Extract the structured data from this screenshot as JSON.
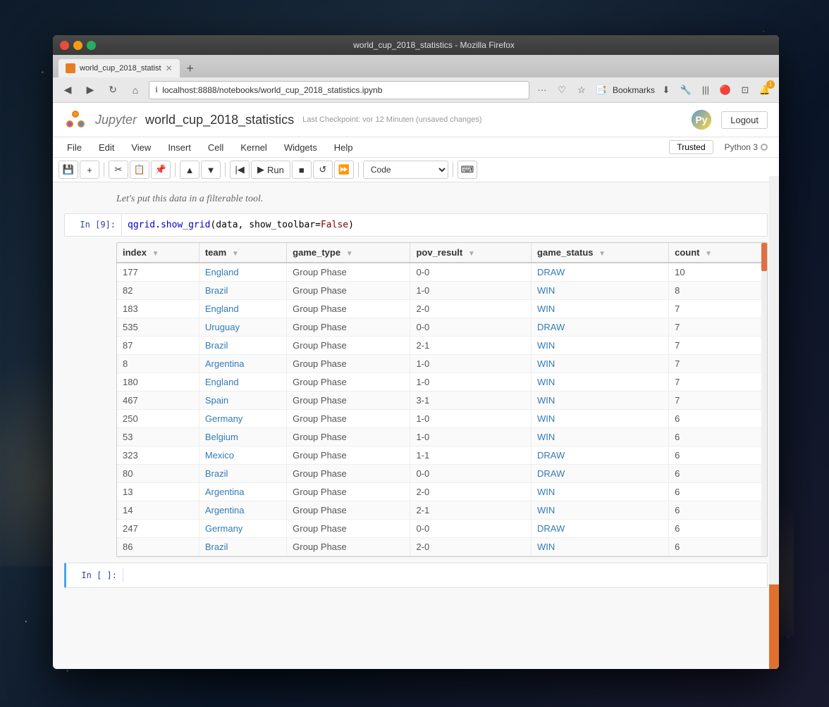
{
  "window": {
    "title": "world_cup_2018_statistics - Mozilla Firefox",
    "tab_label": "world_cup_2018_statist",
    "url": "localhost:8888/notebooks/world_cup_2018_statistics.ipynb"
  },
  "nav": {
    "back": "◀",
    "forward": "▶",
    "refresh": "↻",
    "home": "⌂",
    "menu_dots": "···",
    "bookmark": "☆",
    "bookmarks_label": "Bookmarks",
    "download": "⬇",
    "tools": "🔧",
    "extensions": "|||",
    "lock": "🔒"
  },
  "jupyter": {
    "brand": "Jupyter",
    "notebook_name": "world_cup_2018_statistics",
    "checkpoint_text": "Last Checkpoint: vor 12 Minuten  (unsaved changes)",
    "logout_label": "Logout",
    "trusted_label": "Trusted",
    "kernel_label": "Python 3"
  },
  "menu": {
    "items": [
      "File",
      "Edit",
      "View",
      "Insert",
      "Cell",
      "Kernel",
      "Widgets",
      "Help"
    ]
  },
  "toolbar": {
    "cell_type": "Code",
    "run_label": "Run"
  },
  "cell": {
    "prompt_in": "In [9]:",
    "code": "qgrid.show_grid(data, show_toolbar=False)",
    "text_above": "Let's put this data in a filterable tool."
  },
  "empty_cell": {
    "prompt": "In [ ]:"
  },
  "table": {
    "columns": [
      {
        "key": "index",
        "label": "index"
      },
      {
        "key": "team",
        "label": "team"
      },
      {
        "key": "game_type",
        "label": "game_type"
      },
      {
        "key": "pov_result",
        "label": "pov_result"
      },
      {
        "key": "game_status",
        "label": "game_status"
      },
      {
        "key": "count",
        "label": "count"
      }
    ],
    "rows": [
      {
        "index": "177",
        "team": "England",
        "game_type": "Group Phase",
        "pov_result": "0-0",
        "game_status": "DRAW",
        "count": "10"
      },
      {
        "index": "82",
        "team": "Brazil",
        "game_type": "Group Phase",
        "pov_result": "1-0",
        "game_status": "WIN",
        "count": "8"
      },
      {
        "index": "183",
        "team": "England",
        "game_type": "Group Phase",
        "pov_result": "2-0",
        "game_status": "WIN",
        "count": "7"
      },
      {
        "index": "535",
        "team": "Uruguay",
        "game_type": "Group Phase",
        "pov_result": "0-0",
        "game_status": "DRAW",
        "count": "7"
      },
      {
        "index": "87",
        "team": "Brazil",
        "game_type": "Group Phase",
        "pov_result": "2-1",
        "game_status": "WIN",
        "count": "7"
      },
      {
        "index": "8",
        "team": "Argentina",
        "game_type": "Group Phase",
        "pov_result": "1-0",
        "game_status": "WIN",
        "count": "7"
      },
      {
        "index": "180",
        "team": "England",
        "game_type": "Group Phase",
        "pov_result": "1-0",
        "game_status": "WIN",
        "count": "7"
      },
      {
        "index": "467",
        "team": "Spain",
        "game_type": "Group Phase",
        "pov_result": "3-1",
        "game_status": "WIN",
        "count": "7"
      },
      {
        "index": "250",
        "team": "Germany",
        "game_type": "Group Phase",
        "pov_result": "1-0",
        "game_status": "WIN",
        "count": "6"
      },
      {
        "index": "53",
        "team": "Belgium",
        "game_type": "Group Phase",
        "pov_result": "1-0",
        "game_status": "WIN",
        "count": "6"
      },
      {
        "index": "323",
        "team": "Mexico",
        "game_type": "Group Phase",
        "pov_result": "1-1",
        "game_status": "DRAW",
        "count": "6"
      },
      {
        "index": "80",
        "team": "Brazil",
        "game_type": "Group Phase",
        "pov_result": "0-0",
        "game_status": "DRAW",
        "count": "6"
      },
      {
        "index": "13",
        "team": "Argentina",
        "game_type": "Group Phase",
        "pov_result": "2-0",
        "game_status": "WIN",
        "count": "6"
      },
      {
        "index": "14",
        "team": "Argentina",
        "game_type": "Group Phase",
        "pov_result": "2-1",
        "game_status": "WIN",
        "count": "6"
      },
      {
        "index": "247",
        "team": "Germany",
        "game_type": "Group Phase",
        "pov_result": "0-0",
        "game_status": "DRAW",
        "count": "6"
      },
      {
        "index": "86",
        "team": "Brazil",
        "game_type": "Group Phase",
        "pov_result": "2-0",
        "game_status": "WIN",
        "count": "6"
      }
    ]
  }
}
